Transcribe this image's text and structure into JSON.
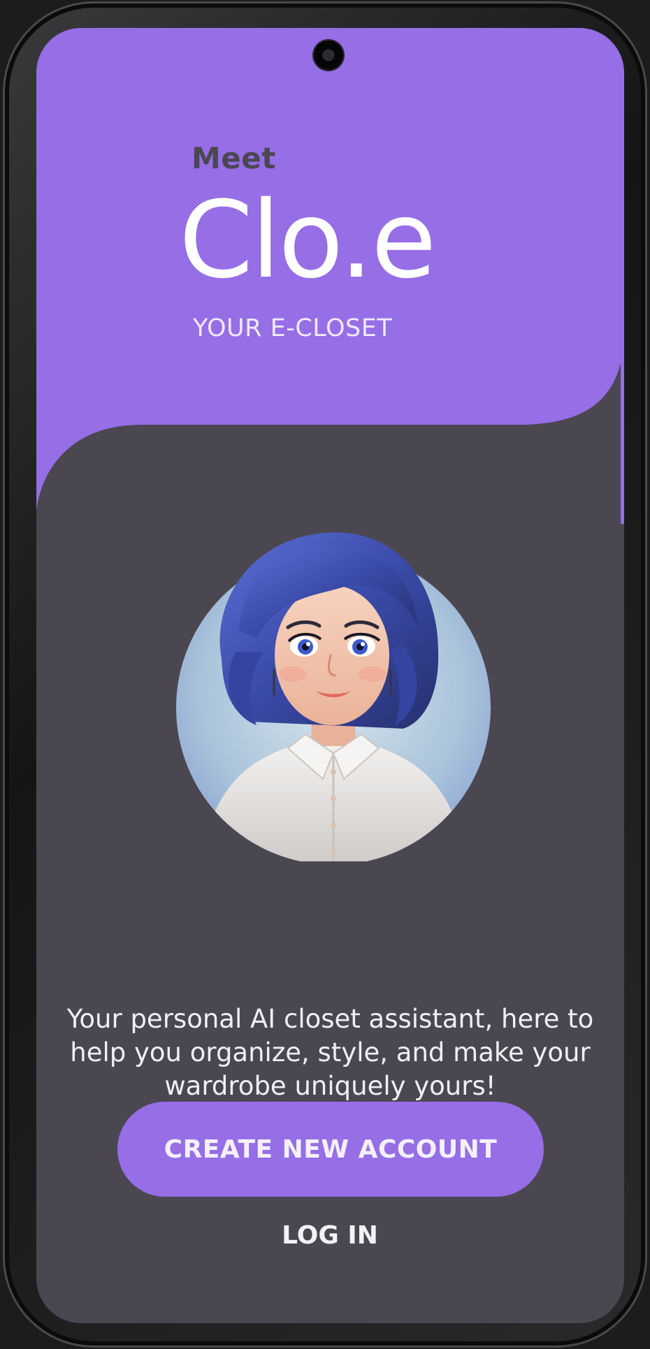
{
  "app": {
    "intro": "Meet",
    "name": "Clo.e",
    "tagline": "YOUR E-CLOSET"
  },
  "hero": {
    "avatar_description": "3D cartoon woman with short wavy blue hair in a white collared shirt"
  },
  "onboarding": {
    "description": "Your personal AI closet assistant, here to help you organize, style, and make your wardrobe uniquely yours!",
    "primary_button_label": "CREATE NEW ACCOUNT",
    "secondary_link_label": "LOG IN"
  },
  "colors": {
    "accent_purple": "#966ee6",
    "background_dark": "#4b4751",
    "text_light": "#f4f2f7"
  },
  "icons": {
    "camera": "front-camera-icon"
  }
}
